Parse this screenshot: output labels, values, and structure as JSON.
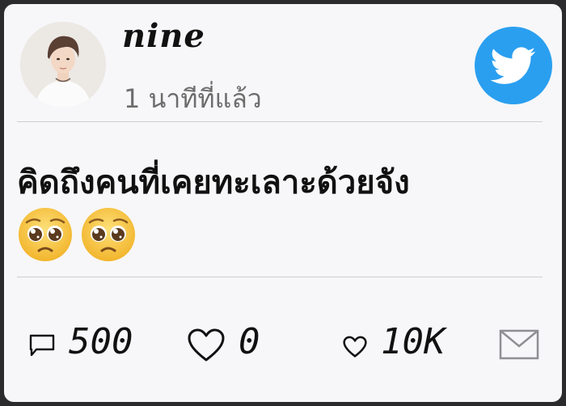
{
  "post": {
    "username": "nine",
    "timestamp": "1 นาทีที่แล้ว",
    "text": "คิดถึงคนที่เคยทะเลาะด้วยจัง",
    "emojis": [
      "pleading-face-emoji",
      "pleading-face-emoji"
    ]
  },
  "stats": {
    "comments": "500",
    "likes": "0",
    "favorites": "10K"
  },
  "icons": {
    "platform": "twitter-bird-icon",
    "comment": "speech-bubble-icon",
    "like": "heart-outline-icon",
    "favorite": "heart-outline-small-icon",
    "share": "envelope-icon"
  },
  "colors": {
    "twitter_blue": "#2a9ff0",
    "card_background": "#f7f7f9",
    "timestamp_gray": "#6d6d6d",
    "emoji_yellow": "#f7c233"
  }
}
